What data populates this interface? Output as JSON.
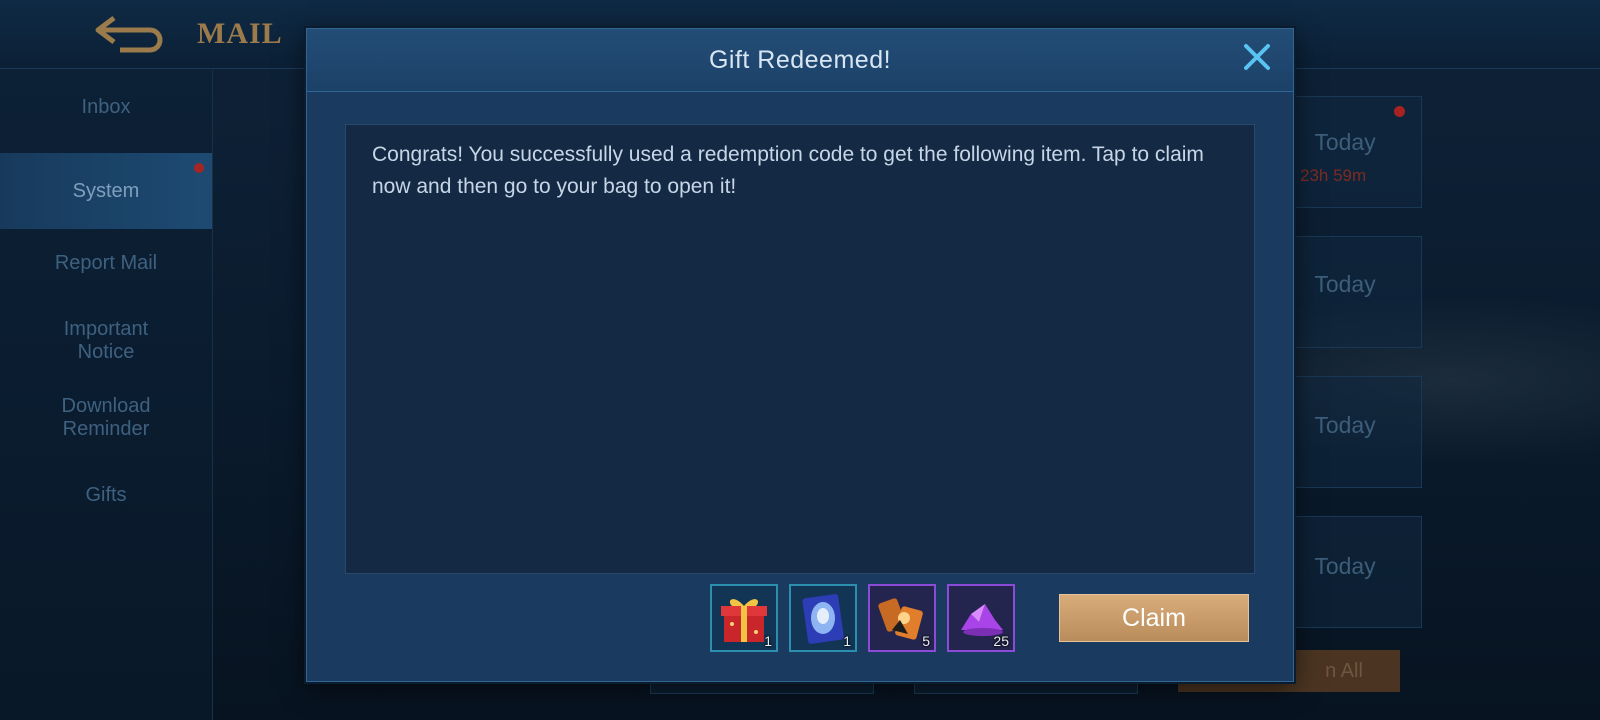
{
  "header": {
    "title": "MAIL",
    "back_icon": "back-arrow-icon"
  },
  "sidebar": {
    "items": [
      {
        "label": "Inbox"
      },
      {
        "label": "System"
      },
      {
        "label": "Report Mail"
      },
      {
        "label": "Important Notice"
      },
      {
        "label": "Download Reminder"
      },
      {
        "label": "Gifts"
      }
    ],
    "active": "System"
  },
  "mail_list": {
    "items": [
      {
        "date": "Today",
        "timer": "23h 59m"
      },
      {
        "date": "Today"
      },
      {
        "date": "Today"
      },
      {
        "date": "Today"
      }
    ],
    "claim_all_label": "n All"
  },
  "modal": {
    "title": "Gift Redeemed!",
    "close_icon": "close-icon",
    "message": "Congrats! You successfully used a redemption code to get the following item. Tap to claim now and then go to your bag to open it!",
    "rewards": [
      {
        "icon": "gift-box-icon",
        "count": "1"
      },
      {
        "icon": "hero-card-icon",
        "count": "1"
      },
      {
        "icon": "emblem-fragment-icon",
        "count": "5"
      },
      {
        "icon": "purple-crystal-icon",
        "count": "25"
      }
    ],
    "claim_label": "Claim"
  },
  "colors": {
    "accent_gold": "#c99c6a",
    "panel_blue": "#1a3b5f",
    "close_blue": "#59c3f2",
    "notification_red": "#a82222"
  }
}
